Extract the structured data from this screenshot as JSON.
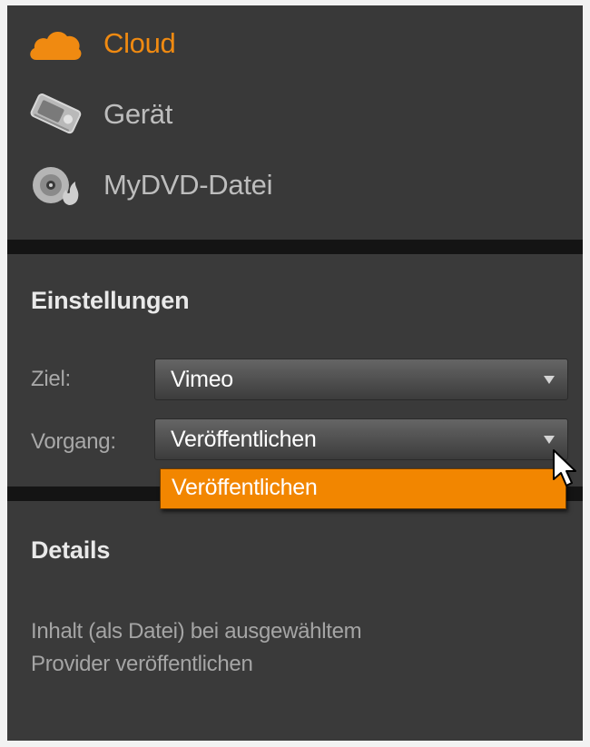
{
  "nav": {
    "items": [
      {
        "label": "Cloud",
        "icon": "cloud-icon",
        "active": true
      },
      {
        "label": "Gerät",
        "icon": "device-drive-icon",
        "active": false
      },
      {
        "label": "MyDVD-Datei",
        "icon": "disc-burn-icon",
        "active": false
      }
    ]
  },
  "settings": {
    "title": "Einstellungen",
    "target_label": "Ziel:",
    "target_value": "Vimeo",
    "operation_label": "Vorgang:",
    "operation_value": "Veröffentlichen",
    "dropdown_options": [
      "Veröffentlichen"
    ]
  },
  "details": {
    "title": "Details",
    "line1": "Inhalt (als Datei) bei ausgewähltem",
    "line2": "Provider veröffentlichen"
  },
  "colors": {
    "accent": "#f08a11",
    "panel": "#3a3a3a",
    "divider": "#141414"
  }
}
